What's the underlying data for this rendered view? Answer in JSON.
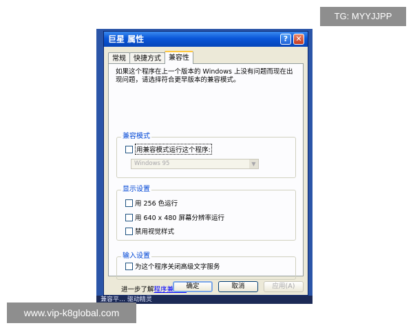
{
  "watermarks": {
    "top": "TG: MYYJJPP",
    "bottom": "www.vip-k8global.com"
  },
  "taskbar": {
    "text": "兼容平… 驱动精灵"
  },
  "window": {
    "title": "巨星 属性",
    "help_glyph": "?",
    "close_glyph": "✕"
  },
  "tabs": [
    {
      "label": "常规",
      "active": false
    },
    {
      "label": "快捷方式",
      "active": false
    },
    {
      "label": "兼容性",
      "active": true
    }
  ],
  "description": "如果这个程序在上一个版本的 Windows 上没有问题而现在出现问题，请选择符合更早版本的兼容模式。",
  "compat_mode": {
    "title": "兼容模式",
    "checkbox_label": "用兼容模式运行这个程序:",
    "checked": false,
    "os_select_value": "Windows 95",
    "os_select_enabled": false
  },
  "display": {
    "title": "显示设置",
    "options": [
      {
        "label": "用 256 色运行",
        "checked": false
      },
      {
        "label": "用 640 x 480 屏幕分辨率运行",
        "checked": false
      },
      {
        "label": "禁用视觉样式",
        "checked": false
      }
    ]
  },
  "input": {
    "title": "输入设置",
    "options": [
      {
        "label": "为这个程序关闭高级文字服务",
        "checked": false
      }
    ]
  },
  "learn_more": {
    "prefix": "进一步了解",
    "link": "程序兼容性",
    "suffix": "。"
  },
  "buttons": {
    "ok": "确定",
    "cancel": "取消",
    "apply": "应用(A)"
  },
  "colors": {
    "titlebar": "#0a56d8",
    "group_title": "#0046d5",
    "link": "#0000ff"
  }
}
